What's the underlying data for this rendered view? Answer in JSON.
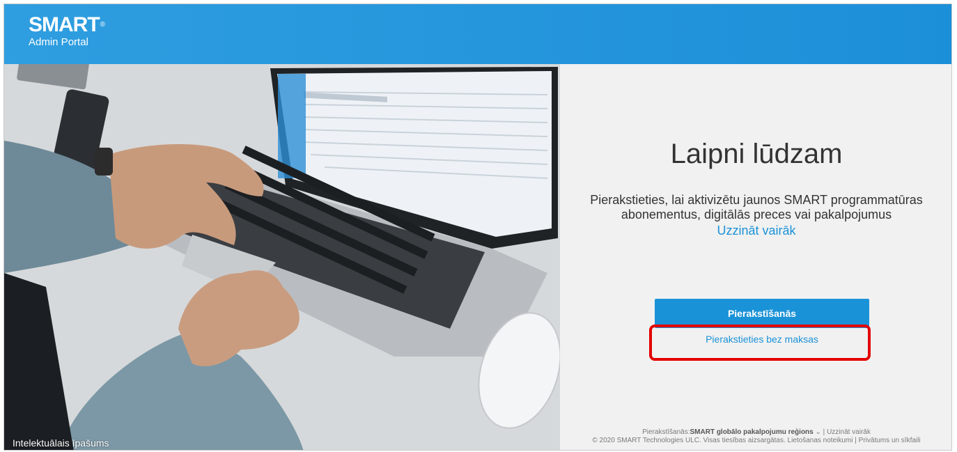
{
  "header": {
    "logo_text": "SMART",
    "logo_mark": "®",
    "subtitle": "Admin Portal"
  },
  "hero": {
    "caption": "Intelektuālais īpašums"
  },
  "panel": {
    "title": "Laipni lūdzam",
    "description": "Pierakstieties, lai aktivizētu jaunos SMART programmatūras abonementus, digitālās preces vai pakalpojumus",
    "learn_more": "Uzzināt vairāk",
    "signin_button": "Pierakstīšanās",
    "free_signup_link": "Pierakstieties bez maksas"
  },
  "footer": {
    "region_prefix": "Pierakstīšanās:",
    "region_value": "SMART globālo pakalpojumu reģions",
    "region_chevron": "⌄",
    "separator": "|",
    "learn_more": "Uzzināt vairāk",
    "copyright": "© 2020 SMART Technologies ULC. Visas tiesības aizsargātas.",
    "terms": "Lietošanas noteikumi",
    "privacy": "Privātums un sīkfaili"
  },
  "colors": {
    "header_blue": "#1c8fd9",
    "accent_blue": "#1a92d7",
    "highlight_red": "#e30000",
    "panel_bg": "#f1f1f1"
  }
}
